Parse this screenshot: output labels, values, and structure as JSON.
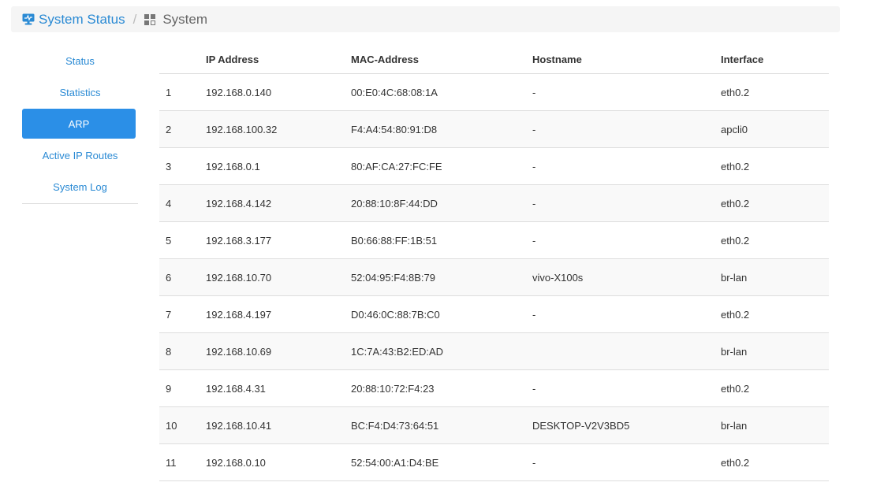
{
  "breadcrumb": {
    "home_label": "System Status",
    "home_icon": "monitor-icon",
    "separator": "/",
    "current_label": "System",
    "current_icon": "grid-icon"
  },
  "colors": {
    "accent": "#2a8ad4",
    "active_bg": "#2b8fe7"
  },
  "sidebar": {
    "items": [
      {
        "label": "Status",
        "active": false
      },
      {
        "label": "Statistics",
        "active": false
      },
      {
        "label": "ARP",
        "active": true
      },
      {
        "label": "Active IP Routes",
        "active": false
      },
      {
        "label": "System Log",
        "active": false
      }
    ]
  },
  "table": {
    "headers": [
      "",
      "IP Address",
      "MAC-Address",
      "Hostname",
      "Interface"
    ],
    "rows": [
      [
        "1",
        "192.168.0.140",
        "00:E0:4C:68:08:1A",
        "-",
        "eth0.2"
      ],
      [
        "2",
        "192.168.100.32",
        "F4:A4:54:80:91:D8",
        "-",
        "apcli0"
      ],
      [
        "3",
        "192.168.0.1",
        "80:AF:CA:27:FC:FE",
        "-",
        "eth0.2"
      ],
      [
        "4",
        "192.168.4.142",
        "20:88:10:8F:44:DD",
        "-",
        "eth0.2"
      ],
      [
        "5",
        "192.168.3.177",
        "B0:66:88:FF:1B:51",
        "-",
        "eth0.2"
      ],
      [
        "6",
        "192.168.10.70",
        "52:04:95:F4:8B:79",
        "vivo-X100s",
        "br-lan"
      ],
      [
        "7",
        "192.168.4.197",
        "D0:46:0C:88:7B:C0",
        "-",
        "eth0.2"
      ],
      [
        "8",
        "192.168.10.69",
        "1C:7A:43:B2:ED:AD",
        "",
        "br-lan"
      ],
      [
        "9",
        "192.168.4.31",
        "20:88:10:72:F4:23",
        "-",
        "eth0.2"
      ],
      [
        "10",
        "192.168.10.41",
        "BC:F4:D4:73:64:51",
        "DESKTOP-V2V3BD5",
        "br-lan"
      ],
      [
        "11",
        "192.168.0.10",
        "52:54:00:A1:D4:BE",
        "-",
        "eth0.2"
      ]
    ]
  }
}
